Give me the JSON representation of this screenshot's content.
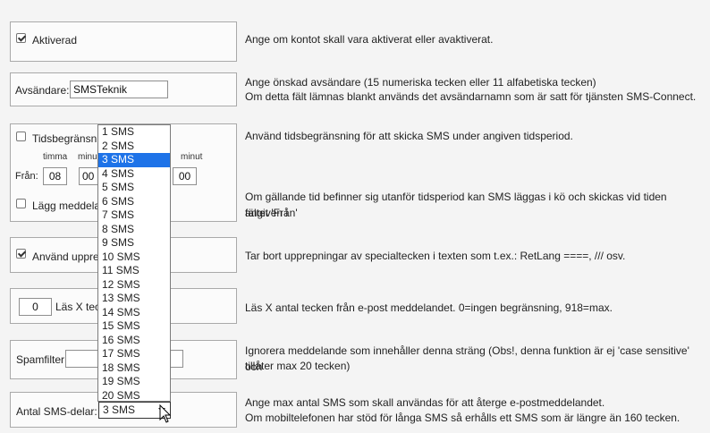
{
  "rows": {
    "activated": {
      "label": "Aktiverad",
      "checked": true,
      "description": "Ange om kontot skall vara aktiverat eller avaktiverat."
    },
    "sender": {
      "label": "Avsändare:",
      "value": "SMSTeknik",
      "description_line1": "Ange önskad avsändare (15 numeriska tecken eller 11 alfabetiska tecken)",
      "description_line2": "Om detta fält lämnas blankt används det avsändarnamn som är satt för tjänsten SMS-Connect."
    },
    "time_limit": {
      "label": "Tidsbegränsni",
      "checked": false,
      "hour_label": "timma",
      "minute_label_left": "minu",
      "minute_label_right": "minut",
      "from_label": "Från:",
      "from_hour": "08",
      "from_minute": "00",
      "to_minute": "00",
      "queue_label": "Lägg meddela",
      "queue_checked": false,
      "description": "Använd tidsbegränsning för att skicka SMS under angiven tidsperiod.",
      "queue_description_line1": "Om gällande tid befinner sig utanför tidsperiod kan SMS läggas i kö och skickas vid tiden angiven i",
      "queue_description_line2": "fältet 'Från'"
    },
    "repetitions": {
      "label": "Använd uppre",
      "checked": true,
      "description": "Tar bort upprepningar av specialtecken i texten som t.ex.: RetLang ====, /// osv."
    },
    "read_chars": {
      "value": "0",
      "label": "Läs X tec",
      "description": "Läs X antal tecken från e-post meddelandet. 0=ingen begränsning, 918=max."
    },
    "spamfilter": {
      "label": "Spamfilter",
      "value": "",
      "description_line1": "Ignorera meddelande som innehåller denna sträng (Obs!, denna funktion är ej 'case sensitive' och",
      "description_line2": "tillåter max 20 tecken)"
    },
    "sms_parts": {
      "label": "Antal SMS-delar:",
      "selected": "3 SMS",
      "description_line1": "Ange max antal SMS som skall användas för att återge e-postmeddelandet.",
      "description_line2": "Om mobiltelefonen har stöd för långa SMS så erhålls ett SMS som är längre än 160 tecken."
    }
  },
  "dropdown": {
    "options": [
      "1 SMS",
      "2 SMS",
      "3 SMS",
      "4 SMS",
      "5 SMS",
      "6 SMS",
      "7 SMS",
      "8 SMS",
      "9 SMS",
      "10 SMS",
      "11 SMS",
      "12 SMS",
      "13 SMS",
      "14 SMS",
      "15 SMS",
      "16 SMS",
      "17 SMS",
      "18 SMS",
      "19 SMS",
      "20 SMS"
    ],
    "selected_index": 2
  },
  "colors": {
    "selection": "#1e73e8",
    "panel_border": "#a9a9a9"
  }
}
